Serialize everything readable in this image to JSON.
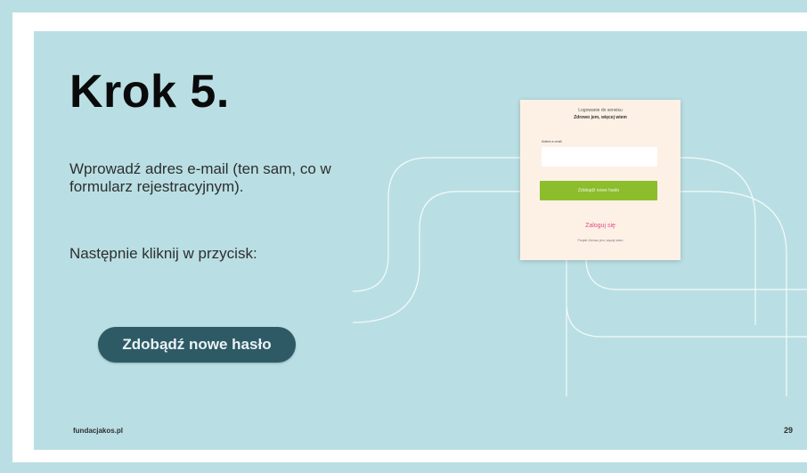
{
  "slide": {
    "title": "Krok 5.",
    "intro": "Wprowadź adres e-mail (ten sam, co w formularz rejestracyjnym).",
    "next_step": "Następnie kliknij w przycisk:",
    "cta_label": "Zdobądź nowe hasło",
    "site": "fundacjakos.pl",
    "page_number": "29"
  },
  "login_card": {
    "pre_heading": "Logowanie do serwisu",
    "greeting": "Zdrowo jem, więcej wiem",
    "email_label": "Adres e-mail",
    "email_value": "",
    "submit_label": "Zdobądź nowe hasło",
    "login_link": "Zaloguj się",
    "footer_note": "Projekt Zdrowo jem, więcej wiem"
  },
  "colors": {
    "background": "#b9dfe4",
    "cta": "#2e5a66",
    "card_bg": "#fdf1e6",
    "card_button": "#8cbd2c",
    "card_link": "#e04a82"
  }
}
